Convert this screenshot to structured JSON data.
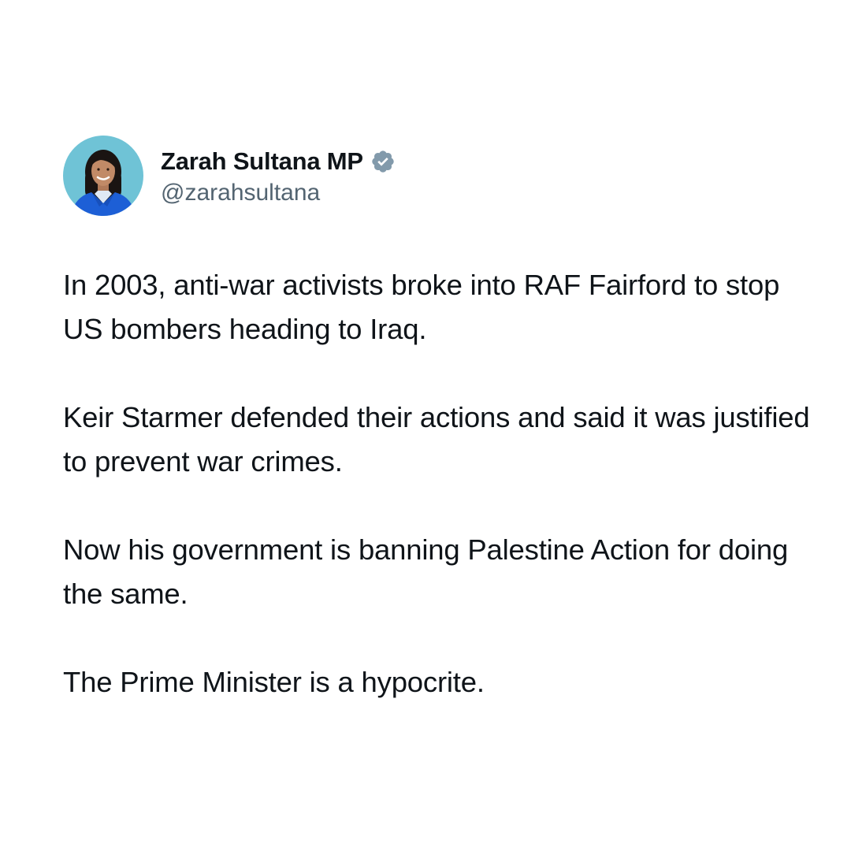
{
  "profile": {
    "display_name": "Zarah Sultana MP",
    "handle": "@zarahsultana",
    "avatar_icon": "profile-photo",
    "badge_icon": "verified-badge-icon",
    "badge_color": "#829aab"
  },
  "tweet": {
    "paragraphs": [
      "In 2003, anti-war activists broke into RAF Fairford to stop US bombers heading to Iraq.",
      "Keir Starmer defended their actions and said it was justified to prevent war crimes.",
      "Now his government is banning Palestine Action for doing the same.",
      "The Prime Minister is a hypocrite."
    ]
  },
  "colors": {
    "background": "#ffffff",
    "text": "#0f1419",
    "secondary_text": "#536471"
  }
}
